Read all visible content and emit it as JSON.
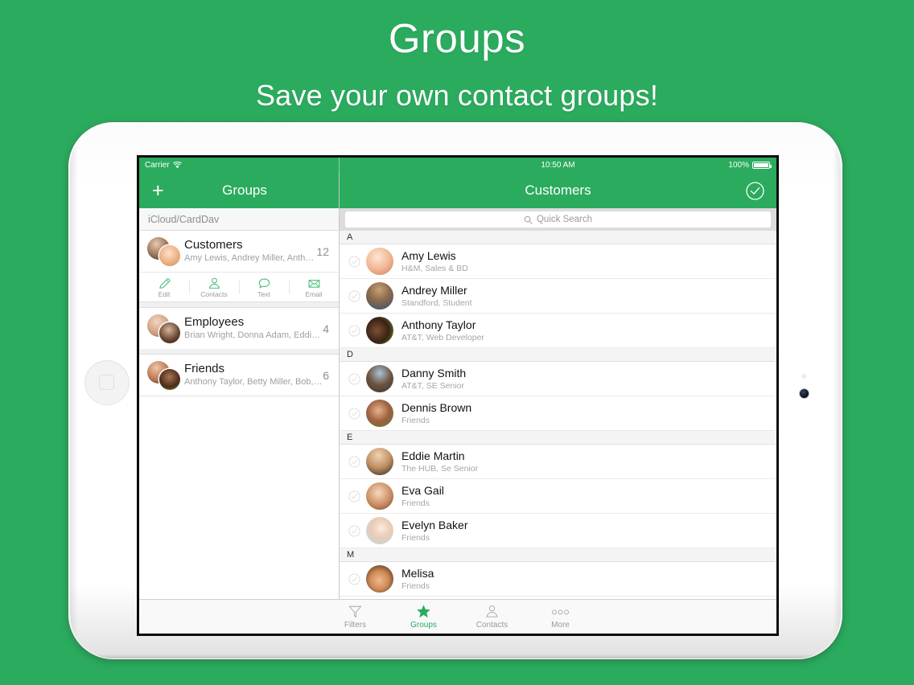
{
  "promo": {
    "title": "Groups",
    "subtitle": "Save your own contact groups!"
  },
  "colors": {
    "background_green": "#2bab5e",
    "navbar_green": "#2bab5e",
    "accent_green": "#2bab5e",
    "muted_gray": "#9a9a9a"
  },
  "statusbar": {
    "carrier": "Carrier",
    "wifi_icon": "wifi-icon",
    "time": "10:50 AM",
    "battery_percent": "100%",
    "battery_icon": "battery-full-icon"
  },
  "left_pane": {
    "nav": {
      "add_icon": "plus-icon",
      "title": "Groups"
    },
    "account_header": "iCloud/CardDav",
    "groups": [
      {
        "name": "Customers",
        "members": "Amy Lewis, Andrey Miller, Anthony Ta…",
        "count": "12",
        "expanded": true
      },
      {
        "name": "Employees",
        "members": "Brian Wright, Donna Adam, Eddie, E…",
        "count": "4",
        "expanded": false
      },
      {
        "name": "Friends",
        "members": "Anthony Taylor, Betty Miller, Bob, Bria…",
        "count": "6",
        "expanded": false
      }
    ],
    "group_actions": [
      {
        "label": "Edit",
        "icon": "pencil-icon"
      },
      {
        "label": "Contacts",
        "icon": "person-icon"
      },
      {
        "label": "Text",
        "icon": "speech-bubble-icon"
      },
      {
        "label": "Email",
        "icon": "envelope-icon"
      }
    ]
  },
  "right_pane": {
    "nav": {
      "title": "Customers",
      "confirm_icon": "check-circle-icon"
    },
    "search": {
      "placeholder": "Quick Search",
      "icon": "search-icon",
      "value": ""
    },
    "sections": [
      {
        "letter": "A",
        "contacts": [
          {
            "name": "Amy Lewis",
            "subtitle": "H&M, Sales & BD",
            "selected": false
          },
          {
            "name": "Andrey Miller",
            "subtitle": "Standford, Student",
            "selected": false
          },
          {
            "name": "Anthony Taylor",
            "subtitle": "AT&T, Web Developer",
            "selected": false
          }
        ]
      },
      {
        "letter": "D",
        "contacts": [
          {
            "name": "Danny Smith",
            "subtitle": "AT&T, SE Senior",
            "selected": false
          },
          {
            "name": "Dennis Brown",
            "subtitle": "Friends",
            "selected": false
          }
        ]
      },
      {
        "letter": "E",
        "contacts": [
          {
            "name": "Eddie Martin",
            "subtitle": "The HUB, Se Senior",
            "selected": false
          },
          {
            "name": "Eva Gail",
            "subtitle": "Friends",
            "selected": false
          },
          {
            "name": "Evelyn Baker",
            "subtitle": "Friends",
            "selected": false
          }
        ]
      },
      {
        "letter": "M",
        "contacts": [
          {
            "name": "Melisa",
            "subtitle": "Friends",
            "selected": false
          }
        ]
      }
    ]
  },
  "tabbar": {
    "tabs": [
      {
        "label": "Filters",
        "icon": "funnel-icon",
        "active": false
      },
      {
        "label": "Groups",
        "icon": "star-icon",
        "active": true
      },
      {
        "label": "Contacts",
        "icon": "person-icon",
        "active": false
      },
      {
        "label": "More",
        "icon": "ellipsis-icon",
        "active": false
      }
    ]
  }
}
